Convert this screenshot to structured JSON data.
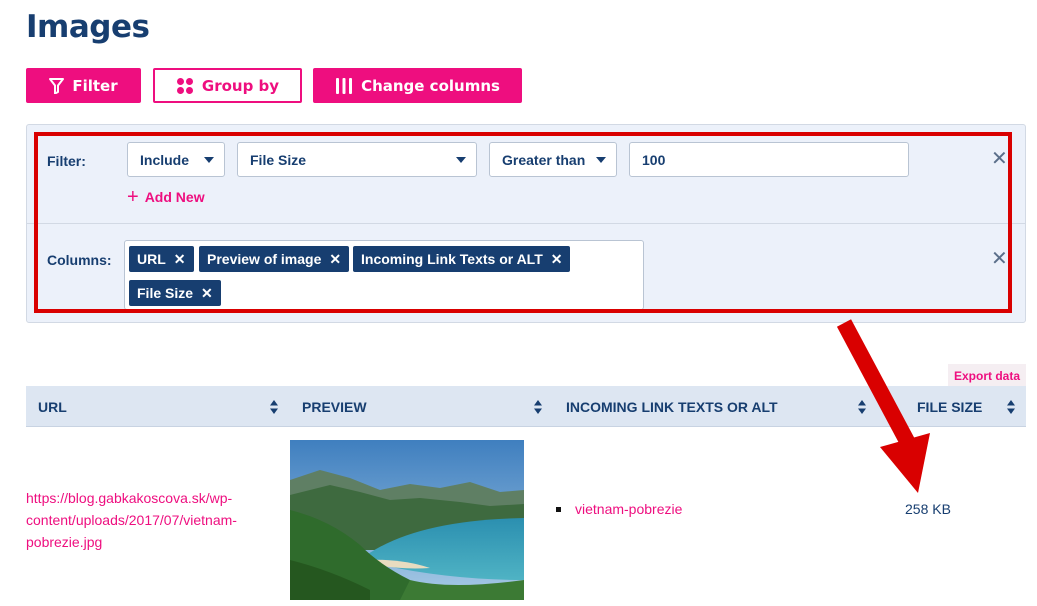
{
  "page": {
    "title": "Images"
  },
  "toolbar": {
    "filter_label": "Filter",
    "group_label": "Group by",
    "columns_label": "Change columns"
  },
  "filter_panel": {
    "filter_label": "Filter:",
    "include_value": "Include",
    "field_value": "File Size",
    "operator_value": "Greater than",
    "amount_value": "100",
    "add_new_label": "Add New",
    "columns_label": "Columns:",
    "column_tags": [
      "URL",
      "Preview of image",
      "Incoming Link Texts or ALT",
      "File Size"
    ]
  },
  "table": {
    "export_label": "Export data",
    "headers": [
      "URL",
      "PREVIEW",
      "INCOMING LINK TEXTS OR ALT",
      "FILE SIZE"
    ],
    "rows": [
      {
        "url": "https://blog.gabkakoscova.sk/wp-content/uploads/2017/07/vietnam-pobrezie.jpg",
        "link_text": "vietnam-pobrezie",
        "file_size": "258 KB"
      }
    ]
  },
  "colors": {
    "accent": "#ee0e7f",
    "navy": "#173e70",
    "panel_bg": "#ecf1fa",
    "annotation_red": "#d90000"
  },
  "icons": {
    "filter": "funnel-icon",
    "group": "four-dots-icon",
    "columns": "columns-icon",
    "close": "close-icon",
    "add": "plus-icon",
    "sort": "sort-icon"
  }
}
